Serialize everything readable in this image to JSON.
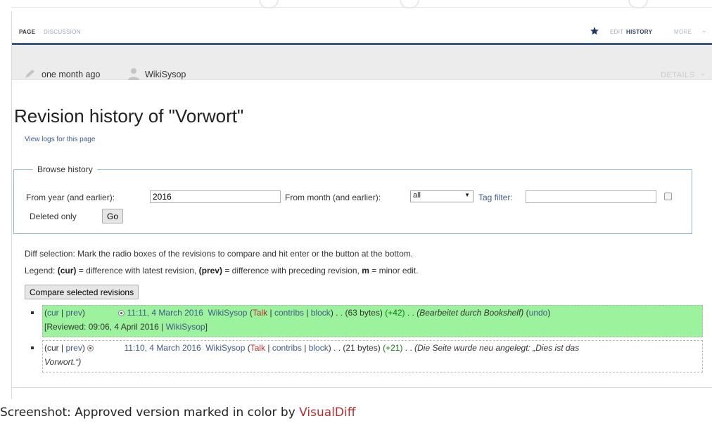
{
  "tabs": {
    "page": "PAGE",
    "discussion": "DISCUSSION",
    "edit": "EDIT",
    "history": "HISTORY",
    "more": "MORE"
  },
  "infobar": {
    "last_edit": "one month ago",
    "user": "WikiSysop",
    "details": "DETAILS"
  },
  "title": "Revision history of \"Vorwort\"",
  "view_logs": "View logs for this page",
  "browse": {
    "legend": "Browse history",
    "year_label": "From year (and earlier):",
    "year_value": "2016",
    "month_label": "From month (and earlier):",
    "month_value": "all",
    "tag_label": "Tag filter:",
    "tag_value": "",
    "deleted_only": "Deleted only",
    "go": "Go"
  },
  "diff_selection": "Diff selection: Mark the radio boxes of the revisions to compare and hit enter or the button at the bottom.",
  "legend_line": {
    "prefix": "Legend:",
    "cur": "(cur)",
    "cur_desc": "= difference with latest revision,",
    "prev": "(prev)",
    "prev_desc": "= difference with preceding revision,",
    "m": "m",
    "m_desc": "= minor edit."
  },
  "compare_button": "Compare selected revisions",
  "revisions": [
    {
      "cur": "cur",
      "prev": "prev",
      "date": "11:11, 4 March 2016",
      "user": "WikiSysop",
      "talk": "Talk",
      "contribs": "contribs",
      "block": "block",
      "size": "(63 bytes)",
      "diff": "(+42)",
      "comment": "(Bearbeitet durch Bookshelf)",
      "undo": "undo",
      "reviewed_prefix": "[Reviewed: 09:06, 4 April 2016 |",
      "reviewer": "WikiSysop",
      "reviewed_suffix": "]"
    },
    {
      "cur": "cur",
      "prev": "prev",
      "date": "11:10, 4 March 2016",
      "user": "WikiSysop",
      "talk": "Talk",
      "contribs": "contribs",
      "block": "block",
      "size": "(21 bytes)",
      "diff": "(+21)",
      "comment_1": "(Die Seite wurde neu angelegt: „Dies ist das",
      "comment_2": "Vorwort.“)"
    }
  ],
  "caption": {
    "text": "Screenshot: Approved version marked in color by",
    "link": "VisualDiff"
  },
  "colors": {
    "approved_highlight": "#9df29d",
    "nav_border": "#3d5686",
    "link": "#3f5a8a",
    "red_link": "#b52f2f",
    "diff_positive": "#0a7a0a"
  },
  "icons": [
    "star-icon",
    "pencil-icon",
    "user-icon",
    "chevron-down-icon"
  ]
}
